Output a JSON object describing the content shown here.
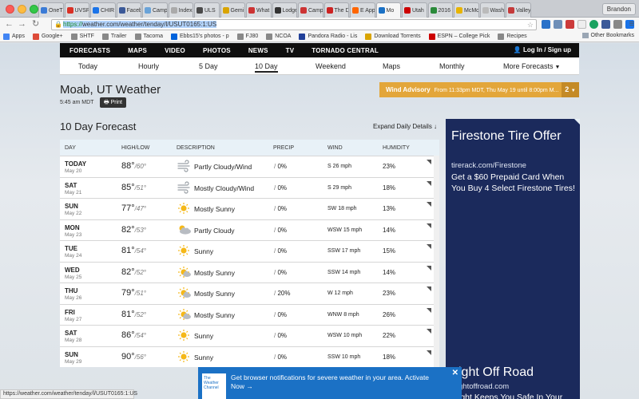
{
  "browser": {
    "tabs": [
      {
        "title": "OneT",
        "color": "#3b7bd6"
      },
      {
        "title": "UVSR",
        "color": "#d93025"
      },
      {
        "title": "CHIR",
        "color": "#1a73e8"
      },
      {
        "title": "Faceb",
        "color": "#3b5998"
      },
      {
        "title": "Camp",
        "color": "#6aa3d8"
      },
      {
        "title": "Index",
        "color": "#aaaaaa"
      },
      {
        "title": "ULS",
        "color": "#4a4a4a"
      },
      {
        "title": "Gemi",
        "color": "#d9a400"
      },
      {
        "title": "What",
        "color": "#cc3333"
      },
      {
        "title": "Lodge",
        "color": "#333333"
      },
      {
        "title": "Camp",
        "color": "#cc3333"
      },
      {
        "title": "The D",
        "color": "#cc2222"
      },
      {
        "title": "E App",
        "color": "#ff6600"
      },
      {
        "title": "Mo",
        "color": "#1b71c5"
      },
      {
        "title": "Utah",
        "color": "#cc0000"
      },
      {
        "title": "2016",
        "color": "#2a8a3a"
      },
      {
        "title": "McMo",
        "color": "#e8b400"
      },
      {
        "title": "Wash",
        "color": "#bbbbbb"
      },
      {
        "title": "Valley",
        "color": "#c43a3a"
      }
    ],
    "user": "Brandon",
    "url": "https://weather.com/weather/tenday/l/USUT0165:1:US",
    "url_scheme": "https://",
    "url_rest": "weather.com/weather/tenday/l/USUT0165:1:US",
    "bookmarks": [
      {
        "label": "Apps",
        "color": "#4285f4"
      },
      {
        "label": "Google+",
        "color": "#dd4b39"
      },
      {
        "label": "SHTF",
        "color": "#888888"
      },
      {
        "label": "Trailer",
        "color": "#888888"
      },
      {
        "label": "Tacoma",
        "color": "#888888"
      },
      {
        "label": "Ebbs15's photos - p",
        "color": "#0063dc"
      },
      {
        "label": "FJ80",
        "color": "#888888"
      },
      {
        "label": "NCOA",
        "color": "#888888"
      },
      {
        "label": "Pandora Radio - Lis",
        "color": "#224099"
      },
      {
        "label": "Download Torrents",
        "color": "#d9a400"
      },
      {
        "label": "ESPN – College Pick",
        "color": "#cc0000"
      },
      {
        "label": "Recipes",
        "color": "#888888"
      }
    ],
    "other_bookmarks": "Other Bookmarks",
    "status_url": "https://weather.com/weather/tenday/l/USUT0165:1:US"
  },
  "nav": {
    "items": [
      "FORECASTS",
      "MAPS",
      "VIDEO",
      "PHOTOS",
      "NEWS",
      "TV",
      "TORNADO CENTRAL"
    ],
    "login": "Log In",
    "signup": "Sign up"
  },
  "subnav": [
    "Today",
    "Hourly",
    "5 Day",
    "10 Day",
    "Weekend",
    "Maps",
    "Monthly",
    "More Forecasts"
  ],
  "location": {
    "title": "Moab, UT Weather",
    "time": "5:45 am MDT",
    "print_label": "Print"
  },
  "advisory": {
    "title": "Wind Advisory",
    "text": "From 11:33pm MDT, Thu May 19 until 8:00pm M...",
    "count": "2"
  },
  "forecast": {
    "title": "10 Day Forecast",
    "expand_label": "Expand Daily Details",
    "headers": {
      "day": "DAY",
      "hilo": "HIGH/LOW",
      "desc": "DESCRIPTION",
      "precip": "PRECIP",
      "wind": "WIND",
      "humidity": "HUMIDITY"
    },
    "rows": [
      {
        "day": "TODAY",
        "date": "May 20",
        "hi": "88°",
        "lo": "60°",
        "icon": "wind",
        "desc": "Partly Cloudy/Wind",
        "precip": "0%",
        "wind": "S 26 mph",
        "humidity": "23%"
      },
      {
        "day": "SAT",
        "date": "May 21",
        "hi": "85°",
        "lo": "51°",
        "icon": "wind",
        "desc": "Mostly Cloudy/Wind",
        "precip": "0%",
        "wind": "S 29 mph",
        "humidity": "18%"
      },
      {
        "day": "SUN",
        "date": "May 22",
        "hi": "77°",
        "lo": "47°",
        "icon": "sun",
        "desc": "Mostly Sunny",
        "precip": "0%",
        "wind": "SW 18 mph",
        "humidity": "13%"
      },
      {
        "day": "MON",
        "date": "May 23",
        "hi": "82°",
        "lo": "53°",
        "icon": "cloud",
        "desc": "Partly Cloudy",
        "precip": "0%",
        "wind": "WSW 15 mph",
        "humidity": "14%"
      },
      {
        "day": "TUE",
        "date": "May 24",
        "hi": "81°",
        "lo": "54°",
        "icon": "sun",
        "desc": "Sunny",
        "precip": "0%",
        "wind": "SSW 17 mph",
        "humidity": "15%"
      },
      {
        "day": "WED",
        "date": "May 25",
        "hi": "82°",
        "lo": "52°",
        "icon": "suncloud",
        "desc": "Mostly Sunny",
        "precip": "0%",
        "wind": "SSW 14 mph",
        "humidity": "14%"
      },
      {
        "day": "THU",
        "date": "May 26",
        "hi": "79°",
        "lo": "51°",
        "icon": "suncloud",
        "desc": "Mostly Sunny",
        "precip": "20%",
        "wind": "W 12 mph",
        "humidity": "23%"
      },
      {
        "day": "FRI",
        "date": "May 27",
        "hi": "81°",
        "lo": "52°",
        "icon": "suncloud",
        "desc": "Mostly Sunny",
        "precip": "0%",
        "wind": "WNW 8 mph",
        "humidity": "26%"
      },
      {
        "day": "SAT",
        "date": "May 28",
        "hi": "86°",
        "lo": "54°",
        "icon": "sun",
        "desc": "Sunny",
        "precip": "0%",
        "wind": "WSW 10 mph",
        "humidity": "22%"
      },
      {
        "day": "SUN",
        "date": "May 29",
        "hi": "90°",
        "lo": "56°",
        "icon": "sun",
        "desc": "Sunny",
        "precip": "0%",
        "wind": "SSW 10 mph",
        "humidity": "18%"
      }
    ]
  },
  "ad": {
    "title": "Firestone Tire Offer",
    "url": "tirerack.com/Firestone",
    "body": "Get a $60 Prepaid Card When You Buy 4 Select Firestone Tires!",
    "title2": "ight Off Road",
    "url2": "ghtoffroad.com",
    "body2": "ight Keeps You Safe In Your"
  },
  "notification": {
    "logo": "The Weather Channel",
    "text": "Get browser notifications for severe weather in your area. Activate Now →",
    "close": "✕"
  },
  "colors": {
    "nav_bg": "#0f0f0f",
    "advisory": "#e3a63a",
    "ad_bg": "#1b2a5c",
    "notification": "#1b71c5",
    "sun": "#f5b818"
  }
}
